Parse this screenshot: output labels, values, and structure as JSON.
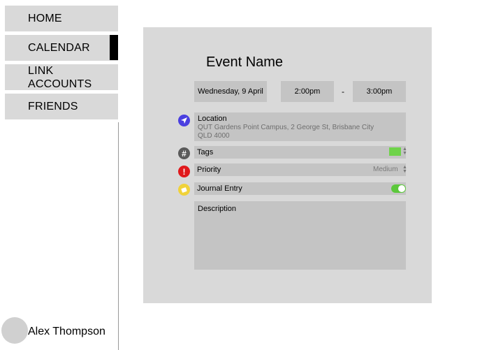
{
  "sidebar": {
    "items": [
      {
        "label": "HOME"
      },
      {
        "label": "CALENDAR"
      },
      {
        "label_line1": "LINK",
        "label_line2": "ACCOUNTS"
      },
      {
        "label": "FRIENDS"
      }
    ],
    "user_name": "Alex Thompson"
  },
  "event": {
    "title": "Event Name",
    "date": "Wednesday, 9 April",
    "start_time": "2:00pm",
    "separator": "-",
    "end_time": "3:00pm",
    "location_label": "Location",
    "location_line1": "QUT Gardens Point Campus, 2 George St, Brisbane City",
    "location_line2": "QLD 4000",
    "tags_label": "Tags",
    "tag_color": "#6fd34a",
    "priority_label": "Priority",
    "priority_value": "Medium",
    "journal_label": "Journal Entry",
    "journal_enabled": true,
    "description_label": "Description"
  },
  "icons": {
    "location": {
      "name": "navigation-arrow-icon",
      "color": "#4a3fe0"
    },
    "tags": {
      "name": "hashtag-icon",
      "color": "#5a5a5a"
    },
    "priority": {
      "name": "exclamation-icon",
      "color": "#e0191c"
    },
    "journal": {
      "name": "journal-icon",
      "color": "#f0d23a"
    }
  },
  "colors": {
    "toggle_on": "#5cc83c"
  }
}
